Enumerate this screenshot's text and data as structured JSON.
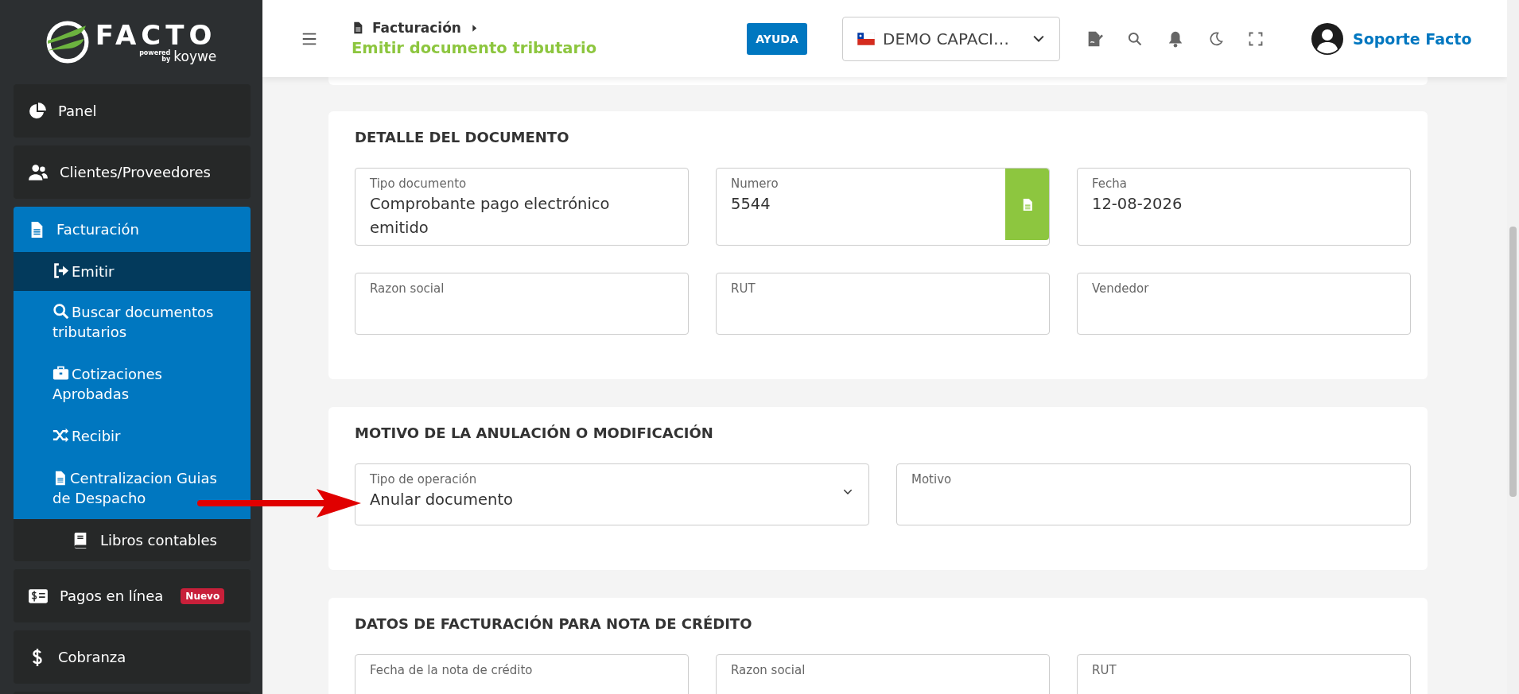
{
  "logo": {
    "name": "FACTO",
    "powered": "powered",
    "by": "by",
    "brand": "koywe"
  },
  "sidebar": {
    "items": [
      {
        "label": "Panel",
        "kind": "main",
        "expanded": false
      },
      {
        "label": "Clientes/Proveedores",
        "kind": "main",
        "expanded": false
      },
      {
        "label": "Facturación",
        "kind": "main",
        "expanded": true,
        "children": [
          {
            "label": "Emitir",
            "selected": true
          },
          {
            "label": "Buscar documentos tributarios",
            "selected": false
          },
          {
            "label": "Cotizaciones Aprobadas",
            "selected": false
          },
          {
            "label": "Recibir",
            "selected": false
          },
          {
            "label": "Centralizacion Guias de Despacho",
            "selected": false
          }
        ]
      },
      {
        "label": "Libros contables",
        "kind": "indented",
        "expanded": false
      },
      {
        "label": "Pagos en línea",
        "kind": "main",
        "expanded": false,
        "badge": "Nuevo"
      },
      {
        "label": "Cobranza",
        "kind": "main",
        "expanded": false
      }
    ]
  },
  "header": {
    "breadcrumb": {
      "section": "Facturación",
      "page": "Emitir documento tributario"
    },
    "help_button": "AYUDA",
    "company_select": {
      "value": "DEMO CAPACI…"
    },
    "user": "Soporte Facto"
  },
  "sections": [
    {
      "title": "DETALLE DEL DOCUMENTO",
      "rows": [
        [
          {
            "label": "Tipo documento",
            "value": "Comprobante pago electrónico emitido",
            "kind": "text"
          },
          {
            "label": "Numero",
            "value": "5544",
            "kind": "with-button"
          },
          {
            "label": "Fecha",
            "value": "12-08-2026",
            "kind": "text"
          }
        ],
        [
          {
            "label": "Razon social",
            "kind": "text"
          },
          {
            "label": "RUT",
            "kind": "text"
          },
          {
            "label": "Vendedor",
            "kind": "text"
          }
        ]
      ]
    },
    {
      "title": "MOTIVO DE LA ANULACIÓN O MODIFICACIÓN",
      "rows": [
        [
          {
            "label": "Tipo de operación",
            "value": "Anular documento",
            "kind": "select"
          },
          {
            "label": "Motivo",
            "kind": "text"
          }
        ]
      ]
    },
    {
      "title": "DATOS DE FACTURACIÓN PARA NOTA DE CRÉDITO",
      "rows": [
        [
          {
            "label": "Fecha de la nota de crédito",
            "kind": "text"
          },
          {
            "label": "Razon social",
            "kind": "text"
          },
          {
            "label": "RUT",
            "kind": "text"
          }
        ]
      ]
    }
  ]
}
